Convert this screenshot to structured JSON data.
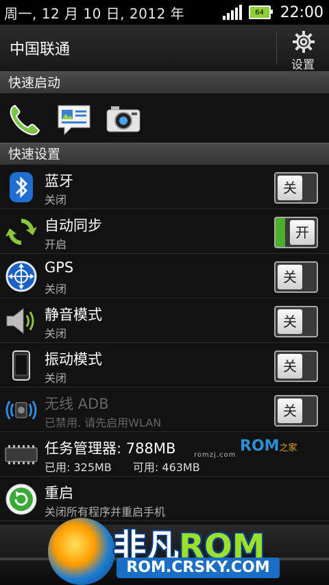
{
  "status_bar": {
    "date": "周一, 12 月 10 日, 2012 年",
    "battery_level": "64",
    "time": "22:00"
  },
  "header": {
    "carrier": "中国联通",
    "settings_label": "设置"
  },
  "quick_launch": {
    "title": "快速启动",
    "items": [
      {
        "icon": "phone-icon"
      },
      {
        "icon": "messages-icon"
      },
      {
        "icon": "camera-icon"
      }
    ]
  },
  "quick_settings": {
    "title": "快速设置",
    "items": [
      {
        "icon": "bluetooth-icon",
        "title": "蓝牙",
        "subtitle": "关闭",
        "toggle": "关",
        "state": "off"
      },
      {
        "icon": "sync-icon",
        "title": "自动同步",
        "subtitle": "开启",
        "toggle": "开",
        "state": "on"
      },
      {
        "icon": "gps-icon",
        "title": "GPS",
        "subtitle": "关闭",
        "toggle": "关",
        "state": "off"
      },
      {
        "icon": "speaker-icon",
        "title": "静音模式",
        "subtitle": "关闭",
        "toggle": "关",
        "state": "off"
      },
      {
        "icon": "vibrate-phone-icon",
        "title": "振动模式",
        "subtitle": "关闭",
        "toggle": "关",
        "state": "off"
      },
      {
        "icon": "wireless-adb-icon",
        "title": "无线 ADB",
        "subtitle": "已禁用. 请先启用WLAN",
        "toggle": "关",
        "state": "off",
        "disabled": true
      }
    ],
    "task_manager": {
      "title": "任务管理器: 788MB",
      "used": "已用: 325MB",
      "available": "可用: 463MB",
      "url": "romzj.com",
      "logo": "ROM",
      "logo_suffix": "之家"
    },
    "reboot": {
      "title": "重启",
      "subtitle": "关闭所有程序并重启手机"
    }
  },
  "watermark": {
    "brand_cn": "非凡",
    "brand_rom": "ROM",
    "url": "ROM.CRSKY.COM"
  },
  "colors": {
    "toggle_on": "#4caf2c",
    "background": "#121212",
    "section_header": "#3d3d3d"
  }
}
